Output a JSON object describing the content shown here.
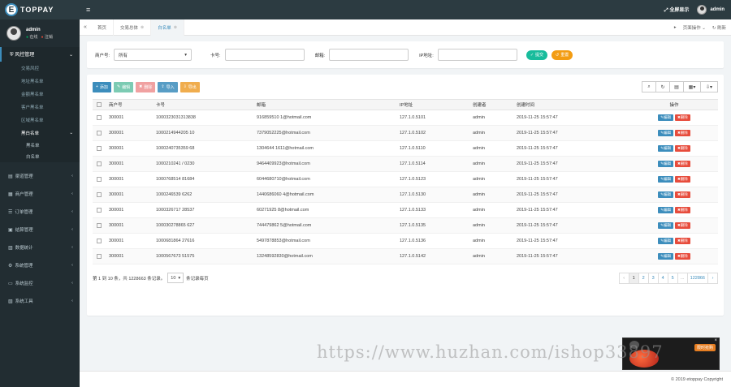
{
  "brand": {
    "logo_letter": "E",
    "name": "TOPPAY"
  },
  "user": {
    "name": "admin",
    "online": "在线",
    "logout": "注销"
  },
  "sidebar": {
    "risk_group": {
      "label": "风控管理",
      "items": [
        "交易风控",
        "地址黑名单",
        "金额黑名单",
        "客户黑名单",
        "区域黑名单"
      ],
      "active_item": "黑白名单",
      "sub_items": [
        "黑名单",
        "白名单"
      ]
    },
    "menus": [
      {
        "icon": "channel-icon",
        "label": "渠道管理"
      },
      {
        "icon": "merchant-icon",
        "label": "商户管理"
      },
      {
        "icon": "order-icon",
        "label": "订单管理"
      },
      {
        "icon": "settle-icon",
        "label": "结算管理"
      },
      {
        "icon": "stats-icon",
        "label": "数据统计"
      },
      {
        "icon": "gear-icon",
        "label": "系统管理"
      },
      {
        "icon": "monitor-icon",
        "label": "系统监控"
      },
      {
        "icon": "tools-icon",
        "label": "系统工具"
      }
    ]
  },
  "topbar": {
    "fullscreen": "全屏显示",
    "user": "admin"
  },
  "tabs": {
    "items": [
      "首页",
      "交易总体",
      "白名单"
    ],
    "active_index": 2,
    "page_ops": "页面操作",
    "refresh": "刷新"
  },
  "filter": {
    "merchant_label": "商户号:",
    "merchant_value": "所有",
    "card_label": "卡号:",
    "email_label": "邮箱:",
    "ip_label": "IP地址:",
    "submit": "提交",
    "reset": "重置"
  },
  "toolbar": {
    "add": "添加",
    "edit": "编辑",
    "delete": "删除",
    "import": "导入",
    "export": "导出"
  },
  "table": {
    "headers": [
      "商户号",
      "卡号",
      "邮箱",
      "IP地址",
      "创建者",
      "创建时间",
      "操作"
    ],
    "edit_label": "编辑",
    "delete_label": "删除",
    "rows": [
      [
        "300001",
        "1000323031313838",
        "916859510 1@hotmail.com",
        "127.1.0.5101",
        "admin",
        "2019-11-25 15:57:47"
      ],
      [
        "300001",
        "1000214944205 10",
        "7379052225@hotmail.com",
        "127.1.0.5102",
        "admin",
        "2019-11-25 15:57:47"
      ],
      [
        "300001",
        "1000240735359 68",
        "1304644 1611@hotmail.com",
        "127.1.0.5110",
        "admin",
        "2019-11-25 15:57:47"
      ],
      [
        "300001",
        "1000210241 / 0230",
        "9464409923@hotmail.com",
        "127.1.0.5114",
        "admin",
        "2019-11-25 15:57:47"
      ],
      [
        "300001",
        "1000768514 81684",
        "6044680710@hotmail.com",
        "127.1.0.5123",
        "admin",
        "2019-11-25 15:57:47"
      ],
      [
        "300001",
        "1000246539 6262",
        "1440686060 4@hotmail.com",
        "127.1.0.5130",
        "admin",
        "2019-11-25 15:57:47"
      ],
      [
        "300001",
        "1000326717 28537",
        "60271925 8@hotmail.com",
        "127.1.0.5133",
        "admin",
        "2019-11-25 15:57:47"
      ],
      [
        "300001",
        "100030278865 627",
        "744479862 5@hotmail.com",
        "127.1.0.5135",
        "admin",
        "2019-11-25 15:57:47"
      ],
      [
        "300001",
        "1000681864 27616",
        "5497878853@hotmail.com",
        "127.1.0.5136",
        "admin",
        "2019-11-25 15:57:47"
      ],
      [
        "300001",
        "1000567673 51575",
        "13248592830@hotmail.com",
        "127.1.0.5142",
        "admin",
        "2019-11-25 15:57:47"
      ]
    ]
  },
  "pager": {
    "summary": "第 1 到 10 条，共 1228663 条记录。",
    "page_size": "10",
    "per_page_suffix": "条记录每页",
    "pages": [
      "‹",
      "1",
      "2",
      "3",
      "4",
      "5",
      "...",
      "122866",
      "›"
    ],
    "active_page": "1"
  },
  "footer": {
    "copyright": "© 2019 etoppay Copyright"
  },
  "watermark": "https://www.huzhan.com/ishop33897",
  "promo": {
    "cta": "限时抢购"
  }
}
